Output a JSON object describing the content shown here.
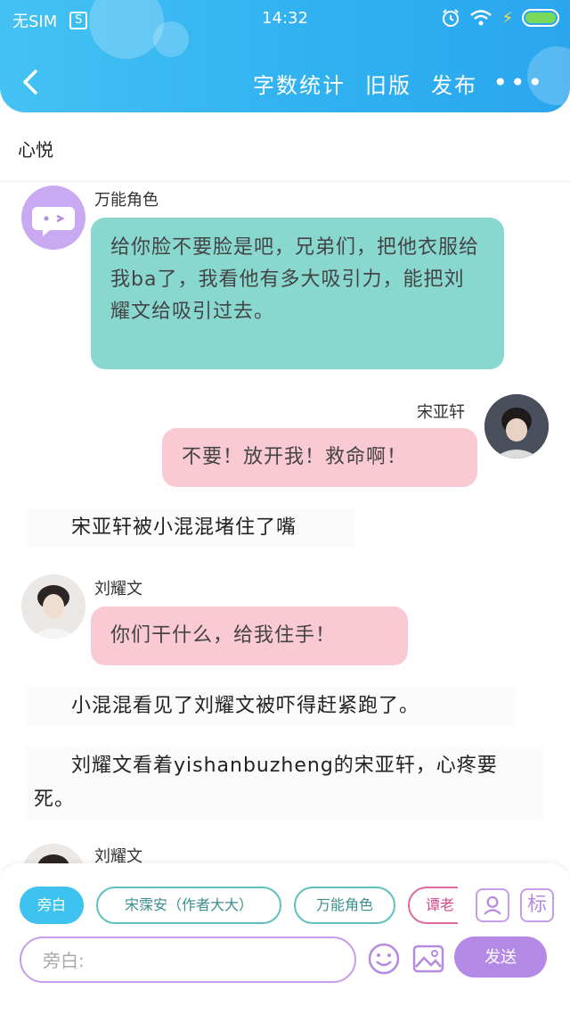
{
  "status_bar": {
    "sim": "无SIM",
    "sim_badge": "S",
    "time": "14:32"
  },
  "nav": {
    "actions": [
      "字数统计",
      "旧版",
      "发布"
    ],
    "more": "•••"
  },
  "story_title": "心悦",
  "messages": [
    {
      "type": "left",
      "name": "万能角色",
      "text": "给你脸不要脸是吧，兄弟们，把他衣服给我ba了，我看他有多大吸引力，能把刘耀文给吸引过去。"
    },
    {
      "type": "right",
      "name": "宋亚轩",
      "text": "不要！放开我！救命啊！"
    },
    {
      "type": "narration",
      "text": "宋亚轩被小混混堵住了嘴"
    },
    {
      "type": "left",
      "name": "刘耀文",
      "text": "你们干什么，给我住手！"
    },
    {
      "type": "narration",
      "text": "小混混看见了刘耀文被吓得赶紧跑了。"
    },
    {
      "type": "narration",
      "text": "刘耀文看着yishanbuzheng的宋亚轩，心疼要死。"
    },
    {
      "type": "left",
      "name": "刘耀文"
    }
  ],
  "composer": {
    "chips": [
      "旁白",
      "宋霂安（作者大大）",
      "万能角色",
      "谭老"
    ],
    "tool_label": "标",
    "input_placeholder": "旁白:",
    "send_label": "发送"
  },
  "colors": {
    "header": "#2fb0f0",
    "teal_bubble": "#89d8d0",
    "pink_bubble": "#f9c9d4",
    "purple": "#b58ae6"
  }
}
